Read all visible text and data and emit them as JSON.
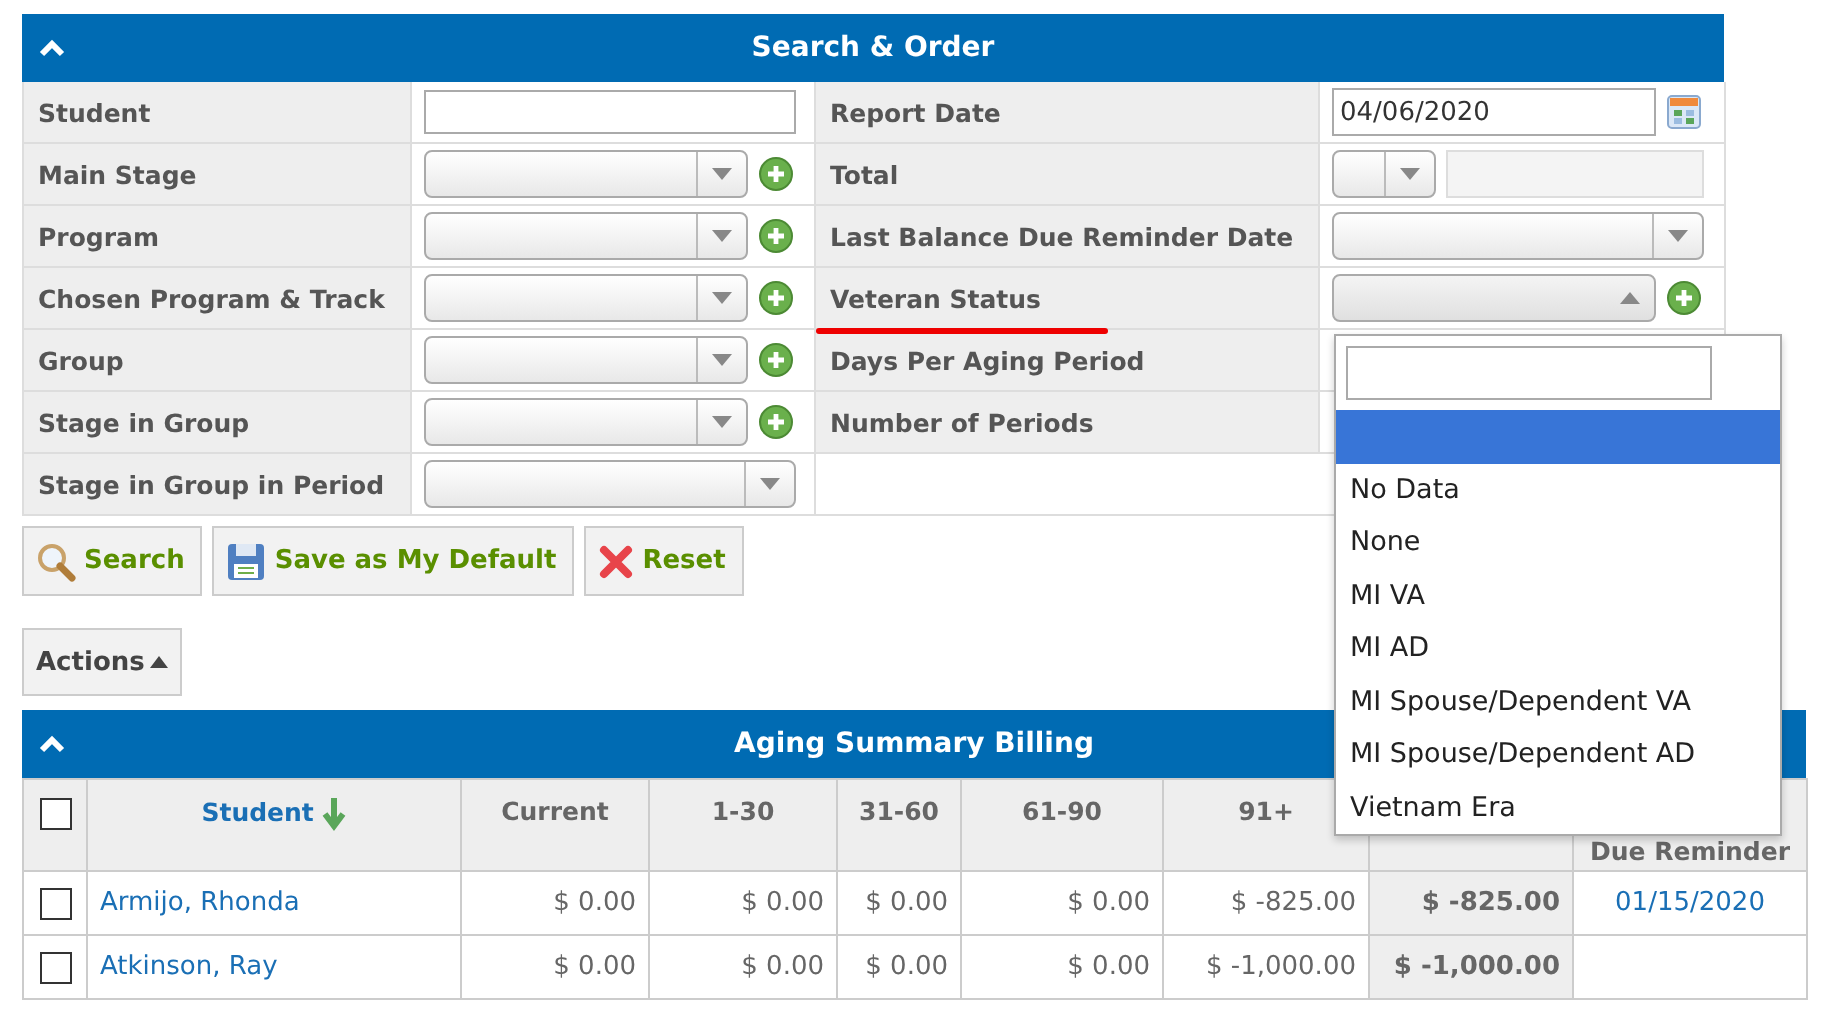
{
  "search_panel": {
    "title": "Search & Order",
    "left_fields": [
      {
        "label": "Student",
        "kind": "text"
      },
      {
        "label": "Main Stage",
        "kind": "select",
        "add": true,
        "expanded": false
      },
      {
        "label": "Program",
        "kind": "select",
        "add": true,
        "expanded": false
      },
      {
        "label": "Chosen Program & Track",
        "kind": "select",
        "add": true,
        "expanded": false
      },
      {
        "label": "Group",
        "kind": "select",
        "add": true,
        "expanded": false
      },
      {
        "label": "Stage in Group",
        "kind": "select",
        "add": true,
        "expanded": false
      },
      {
        "label": "Stage in Group in Period",
        "kind": "select",
        "add": false,
        "expanded": false
      }
    ],
    "right_fields": [
      {
        "label": "Report Date",
        "kind": "date",
        "value": "04/06/2020"
      },
      {
        "label": "Total",
        "kind": "operator"
      },
      {
        "label": "Last Balance Due Reminder Date",
        "kind": "select",
        "add": false,
        "expanded": false
      },
      {
        "label": "Veteran Status",
        "kind": "select",
        "add": true,
        "expanded": true,
        "underlined": true
      },
      {
        "label": "Days Per Aging Period",
        "kind": "hidden"
      },
      {
        "label": "Number of Periods",
        "kind": "hidden"
      },
      {
        "kind": "blank"
      }
    ],
    "dropdown": {
      "options": [
        {
          "selected": true
        },
        {
          "label": "No Data",
          "selected": false
        },
        {
          "label": "None",
          "selected": false
        },
        {
          "label": "MI VA",
          "selected": false
        },
        {
          "label": "MI AD",
          "selected": false
        },
        {
          "label": "MI Spouse/Dependent VA",
          "selected": false
        },
        {
          "label": "MI Spouse/Dependent AD",
          "selected": false
        },
        {
          "label": "Vietnam Era",
          "selected": false
        }
      ]
    }
  },
  "buttons": [
    {
      "label": "Search",
      "kind": "search"
    },
    {
      "label": "Save as My Default",
      "kind": "save"
    },
    {
      "label": "Reset",
      "kind": "reset"
    }
  ],
  "actions": {
    "label": "Actions"
  },
  "aging_table": {
    "title": "Aging Summary Billing",
    "columns": [
      {
        "kind": "checkbox",
        "checked": false
      },
      {
        "kind": "sort",
        "label": "Student"
      },
      {
        "kind": "text",
        "label": "Current"
      },
      {
        "kind": "text",
        "label": "1-30"
      },
      {
        "kind": "text",
        "label": "31-60"
      },
      {
        "kind": "text",
        "label": "61-90"
      },
      {
        "kind": "text",
        "label": "91+"
      },
      {
        "kind": "text"
      },
      {
        "kind": "text",
        "label": "Due Reminder"
      }
    ],
    "rows": [
      {
        "checked": false,
        "student": "Armijo, Rhonda",
        "current": "$ 0.00",
        "d1_30": "$ 0.00",
        "d31_60": "$ 0.00",
        "d61_90": "$ 0.00",
        "d91": "$ -825.00",
        "total": "$ -825.00",
        "reminder": "01/15/2020"
      },
      {
        "checked": false,
        "student": "Atkinson, Ray",
        "current": "$ 0.00",
        "d1_30": "$ 0.00",
        "d31_60": "$ 0.00",
        "d61_90": "$ 0.00",
        "d91": "$ -1,000.00",
        "total": "$ -1,000.00"
      }
    ]
  }
}
